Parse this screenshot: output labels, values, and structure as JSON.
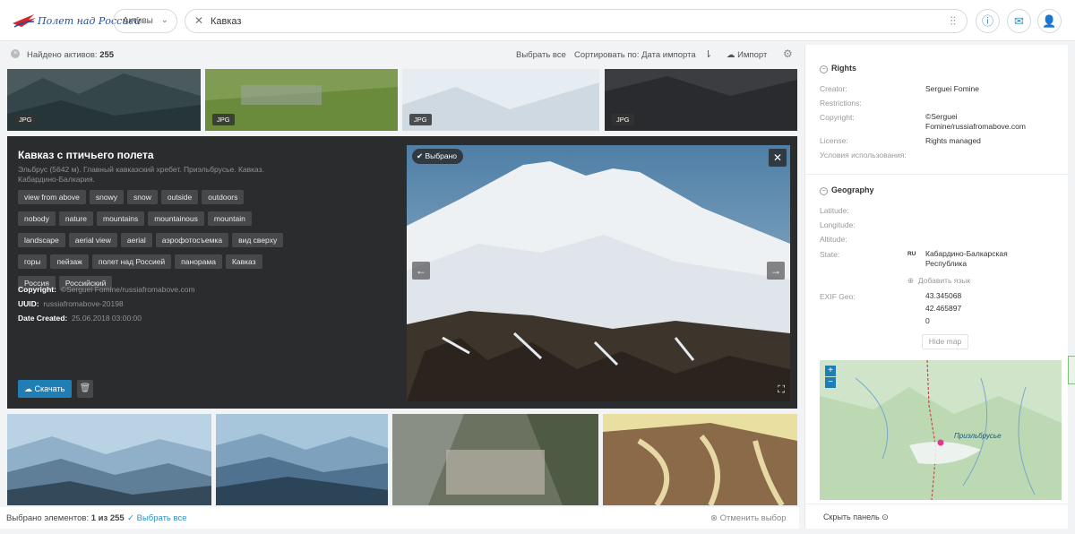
{
  "header": {
    "logo_text": "Полет над Россией",
    "scope_label": "Активы",
    "search_query": "Кавказ",
    "icons": [
      "close-icon",
      "filters-icon",
      "info-icon",
      "inbox-icon",
      "user-icon"
    ]
  },
  "toolbar": {
    "found_label": "Найдено активов:",
    "found_count": "255",
    "select_all": "Выбрать все",
    "sort_label": "Сортировать по:",
    "sort_value": "Дата импорта",
    "import_label": "Импорт"
  },
  "thumbs_top": [
    {
      "badge": "JPG"
    },
    {
      "badge": "JPG"
    },
    {
      "badge": "JPG"
    },
    {
      "badge": "JPG"
    }
  ],
  "detail": {
    "title": "Кавказ с птичьего полета",
    "description": "Эльбрус (5642 м). Главный кавказский хребет. Приэльбрусье. Кавказ. Кабардино-Балкария.",
    "tags": [
      "view from above",
      "snowy",
      "snow",
      "outside",
      "outdoors",
      "nobody",
      "nature",
      "mountains",
      "mountainous",
      "mountain",
      "landscape",
      "aerial view",
      "aerial",
      "аэрофотосъемка",
      "вид сверху",
      "горы",
      "пейзаж",
      "полет над Россией",
      "панорама",
      "Кавказ",
      "Россия",
      "Российский"
    ],
    "copyright_label": "Copyright:",
    "copyright_value": "©Serguei Fomine/russiafromabove.com",
    "uuid_label": "UUID:",
    "uuid_value": "russiafromabove-20198",
    "date_label": "Date Created:",
    "date_value": "25.06.2018 03:00:00",
    "download_label": "Скачать",
    "selected_pill": "Выбрано"
  },
  "bottombar": {
    "selected_label": "Выбрано элементов:",
    "selected_value": "1 из 255",
    "select_all": "Выбрать все",
    "cancel": "Отменить выбор"
  },
  "panel": {
    "rights_title": "Rights",
    "creator_label": "Creator:",
    "creator_value": "Serguei Fomine",
    "restrictions_label": "Restrictions:",
    "copyright_label": "Copyright:",
    "copyright_value": "©Serguei Fomine/russiafromabove.com",
    "license_label": "License:",
    "license_value": "Rights managed",
    "terms_label": "Условия использования:",
    "geo_title": "Geography",
    "latitude_label": "Latitude:",
    "longitude_label": "Longitude:",
    "altitude_label": "Altitude:",
    "state_label": "State:",
    "state_lang": "RU",
    "state_value": "Кабардино-Балкарская Республика",
    "add_lang": "Добавить язык",
    "exif_label": "EXIF Geo:",
    "exif_lat": "43.345068",
    "exif_lon": "42.465897",
    "exif_alt": "0",
    "hide_map": "Hide map",
    "map_label": "Приэльбрусье",
    "hide_panel": "Скрыть панель"
  },
  "colors": {
    "accent": "#1f7fb4",
    "detail_bg": "#2b2c2e",
    "tag_bg": "#46484c"
  }
}
